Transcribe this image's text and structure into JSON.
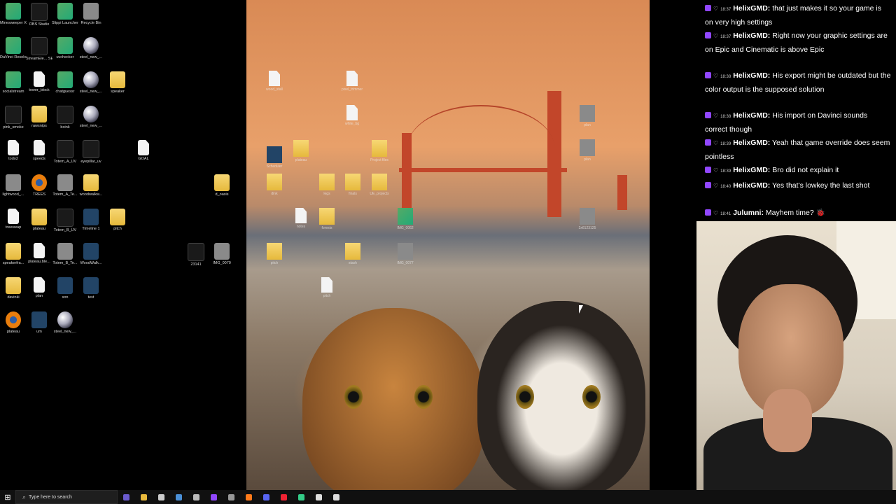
{
  "desktop": {
    "icons": [
      {
        "label": "Minesweeper X",
        "type": "app"
      },
      {
        "label": "OBS Studio",
        "type": "dark"
      },
      {
        "label": "Slippi Launcher",
        "type": "app"
      },
      {
        "label": "Recycle Bin",
        "type": "grey"
      },
      {
        "label": "DaVinci Resolve",
        "type": "app"
      },
      {
        "label": "StreamEle... SE.Live",
        "type": "dark"
      },
      {
        "label": "uvchecker",
        "type": "app"
      },
      {
        "label": "steel_new_...",
        "type": "sphere"
      },
      {
        "label": "socialstream",
        "type": "app"
      },
      {
        "label": "tower_block",
        "type": "file"
      },
      {
        "label": "chatguessr",
        "type": "app"
      },
      {
        "label": "steel_new_...",
        "type": "sphere"
      },
      {
        "label": "speaker",
        "type": "folder"
      },
      {
        "label": "pink_smoke",
        "type": "dark"
      },
      {
        "label": "rawsnips",
        "type": "folder"
      },
      {
        "label": "boink",
        "type": "dark"
      },
      {
        "label": "steel_new_...",
        "type": "sphere"
      },
      {
        "label": "todo2",
        "type": "file"
      },
      {
        "label": "speeds",
        "type": "file"
      },
      {
        "label": "Totem_A_UV",
        "type": "dark"
      },
      {
        "label": "eyepillar_uv",
        "type": "dark"
      },
      {
        "label": "GOAL",
        "type": "file"
      },
      {
        "label": "lightwood_...",
        "type": "grey"
      },
      {
        "label": "TREES",
        "type": "blender"
      },
      {
        "label": "Totem_A_Te...",
        "type": "grey"
      },
      {
        "label": "woodwalkw...",
        "type": "folder"
      },
      {
        "label": "d_oasis",
        "type": "folder"
      },
      {
        "label": "treeswap",
        "type": "file"
      },
      {
        "label": "plateau",
        "type": "folder"
      },
      {
        "label": "Totem_B_UV",
        "type": "dark"
      },
      {
        "label": "Timeline 1",
        "type": "blue"
      },
      {
        "label": "pitch",
        "type": "folder"
      },
      {
        "label": "speakerfra...",
        "type": "folder"
      },
      {
        "label": "plateau.ble...",
        "type": "file"
      },
      {
        "label": "Totem_B_Te...",
        "type": "grey"
      },
      {
        "label": "WoodWalk...",
        "type": "blue"
      },
      {
        "label": "23141",
        "type": "dark"
      },
      {
        "label": "IMG_0070",
        "type": "grey"
      },
      {
        "label": "davinki",
        "type": "folder"
      },
      {
        "label": "plan",
        "type": "file"
      },
      {
        "label": "son",
        "type": "blue"
      },
      {
        "label": "test",
        "type": "blue"
      },
      {
        "label": "plateau",
        "type": "blender"
      },
      {
        "label": "um",
        "type": "blue"
      },
      {
        "label": "steel_new_...",
        "type": "sphere"
      }
    ]
  },
  "wallpaper": {
    "icons": [
      {
        "label": "wood_stall",
        "type": "file"
      },
      {
        "label": "pixel_trimmer",
        "type": "file"
      },
      {
        "label": "white_bg",
        "type": "file"
      },
      {
        "label": "plan",
        "type": "grey"
      },
      {
        "label": "plan",
        "type": "grey"
      },
      {
        "label": "Scheduler",
        "type": "blue"
      },
      {
        "label": "plateau",
        "type": "folder"
      },
      {
        "label": "Project files",
        "type": "folder"
      },
      {
        "label": "dink",
        "type": "folder"
      },
      {
        "label": "legs",
        "type": "folder"
      },
      {
        "label": "finals",
        "type": "folder"
      },
      {
        "label": "UE_projects",
        "type": "folder"
      },
      {
        "label": "notes",
        "type": "file"
      },
      {
        "label": "forests",
        "type": "folder"
      },
      {
        "label": "IMG_0062",
        "type": "app"
      },
      {
        "label": "2x6123125",
        "type": "grey"
      },
      {
        "label": "pitch",
        "type": "folder"
      },
      {
        "label": "stash",
        "type": "folder"
      },
      {
        "label": "IMG_0077",
        "type": "grey"
      },
      {
        "label": "pitch",
        "type": "file"
      }
    ]
  },
  "chat": {
    "messages": [
      {
        "time": "18:37",
        "user": "HelixGMD",
        "text": "that just makes it so your game is on very high settings"
      },
      {
        "time": "18:37",
        "user": "HelixGMD",
        "text": "Right now your graphic settings are on Epic and Cinematic is above Epic"
      },
      {
        "time": "18:38",
        "user": "HelixGMD",
        "text": "His export might be outdated but the color output is the supposed solution"
      },
      {
        "time": "18:38",
        "user": "HelixGMD",
        "text": "His import on Davinci sounds correct though"
      },
      {
        "time": "18:39",
        "user": "HelixGMD",
        "text": "Yeah that game override does seem pointless"
      },
      {
        "time": "18:39",
        "user": "HelixGMD",
        "text": "Bro did not explain it"
      },
      {
        "time": "18:40",
        "user": "HelixGMD",
        "text": "Yes that's lowkey the last shot"
      },
      {
        "time": "18:41",
        "user": "Julumni",
        "text": "Mayhem time? 🐞"
      }
    ]
  },
  "taskbar": {
    "search_placeholder": "Type here to search",
    "apps": [
      {
        "name": "edge",
        "color": "#6a5acd"
      },
      {
        "name": "file-explorer",
        "color": "#e8b93c"
      },
      {
        "name": "app",
        "color": "#ccc"
      },
      {
        "name": "steam",
        "color": "#4a8fd6"
      },
      {
        "name": "photoshop",
        "color": "#bbb"
      },
      {
        "name": "twitch",
        "color": "#9147ff"
      },
      {
        "name": "tool",
        "color": "#999"
      },
      {
        "name": "firefox",
        "color": "#ff7a1a"
      },
      {
        "name": "discord",
        "color": "#5865f2"
      },
      {
        "name": "davinci",
        "color": "#e23"
      },
      {
        "name": "app",
        "color": "#3c8"
      },
      {
        "name": "settings",
        "color": "#ddd"
      },
      {
        "name": "obs",
        "color": "#ddd"
      }
    ]
  }
}
